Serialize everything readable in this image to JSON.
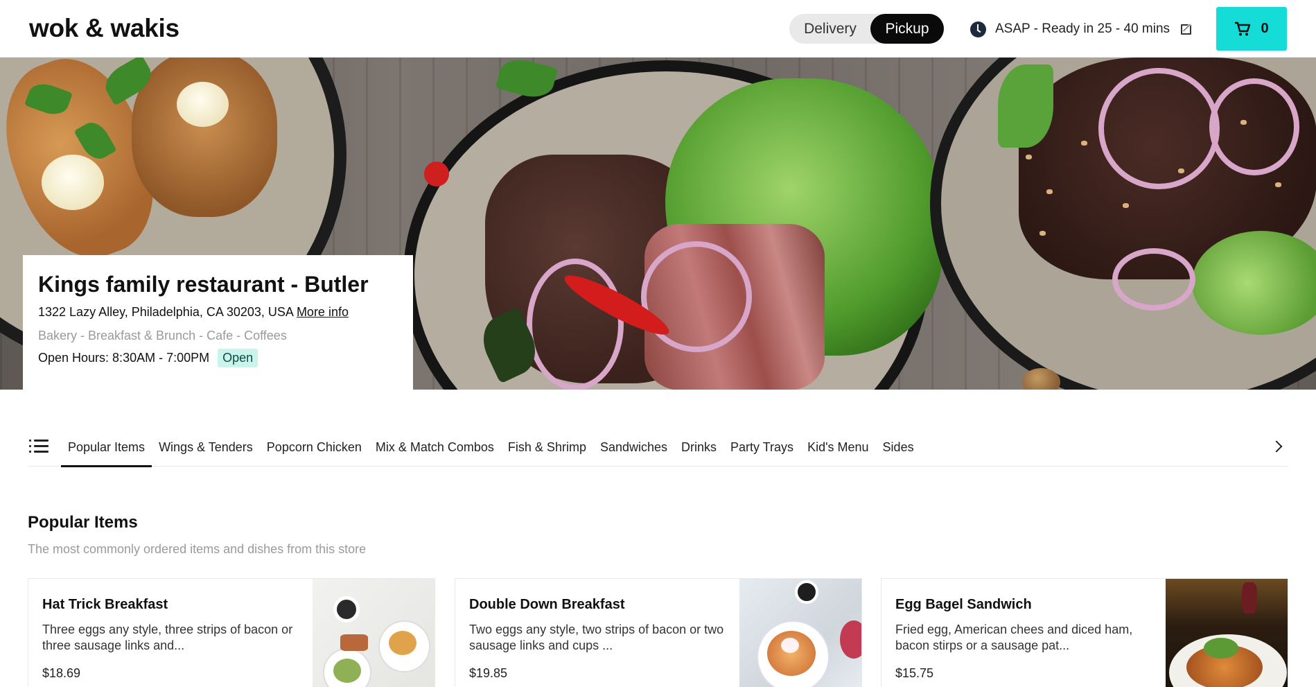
{
  "header": {
    "logo": "wok & wakis",
    "modes": {
      "delivery": "Delivery",
      "pickup": "Pickup",
      "selected": "Pickup"
    },
    "eta_text": "ASAP - Ready in 25 - 40 mins",
    "cart_count": "0",
    "icons": {
      "eta": "clock-icon",
      "edit": "edit-icon",
      "cart": "cart-icon"
    },
    "colors": {
      "cart_bg": "#15dcd7",
      "toggle_active": "#0a0a0a"
    }
  },
  "restaurant": {
    "name": "Kings family restaurant - Butler",
    "address": "1322 Lazy Alley, Philadelphia, CA 30203, USA",
    "more_info": "More info",
    "tags": "Bakery - Breakfast & Brunch - Cafe - Coffees",
    "hours": "Open Hours: 8:30AM - 7:00PM",
    "status": "Open",
    "status_color": "#c8f4ec"
  },
  "categories": {
    "items": [
      "Popular Items",
      "Wings & Tenders",
      "Popcorn Chicken",
      "Mix & Match Combos",
      "Fish & Shrimp",
      "Sandwiches",
      "Drinks",
      "Party Trays",
      "Kid's Menu",
      "Sides"
    ],
    "active": "Popular Items"
  },
  "section": {
    "title": "Popular Items",
    "subtitle": "The most commonly ordered items and dishes from this store"
  },
  "menu_items": [
    {
      "name": "Hat Trick Breakfast",
      "description": "Three eggs any style, three strips of bacon or three sausage links and...",
      "price": "$18.69"
    },
    {
      "name": "Double Down Breakfast",
      "description": "Two eggs any style, two strips of bacon or two sausage links and cups ...",
      "price": "$19.85"
    },
    {
      "name": "Egg Bagel Sandwich",
      "description": "Fried egg, American chees and diced ham, bacon stirps or a sausage pat...",
      "price": "$15.75"
    }
  ]
}
